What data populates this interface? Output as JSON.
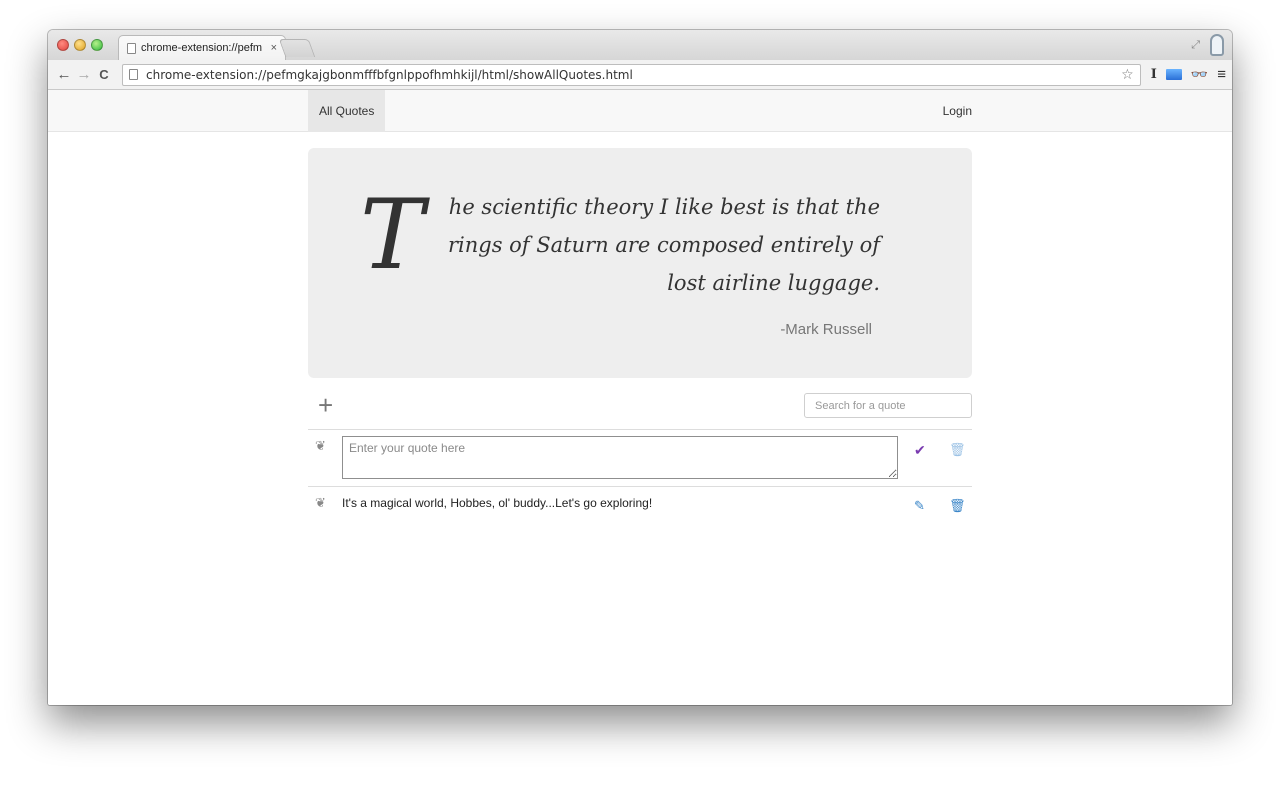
{
  "browser": {
    "tab_title": "chrome-extension://pefm",
    "tab_close": "×",
    "url": "chrome-extension://pefmgkajgbonmfffbfgnlppofhmhkijl/html/showAllQuotes.html",
    "icons": {
      "back": "←",
      "forward": "→",
      "reload": "C",
      "star": "☆",
      "ext_i": "I",
      "glasses": "👓",
      "menu": "≡",
      "fullscreen": "⤢"
    }
  },
  "navbar": {
    "all_quotes": "All Quotes",
    "login": "Login"
  },
  "hero": {
    "dropcap": "T",
    "quote": "he scientific theory I like best is that the rings of Saturn are composed entirely of lost airline luggage.",
    "author": "-Mark Russell"
  },
  "actions": {
    "plus": "+",
    "search_placeholder": "Search for a quote"
  },
  "new_quote": {
    "placeholder": "Enter your quote here",
    "leaf": "❦",
    "check": "✔",
    "trash": "🗑"
  },
  "quotes": [
    {
      "text": "It's a magical world, Hobbes, ol' buddy...Let's go exploring!",
      "leaf": "❦",
      "pencil": "✎",
      "trash": "🗑"
    }
  ],
  "colors": {
    "accent_purple": "#7a3bb0",
    "accent_blue": "#3b86c8"
  }
}
